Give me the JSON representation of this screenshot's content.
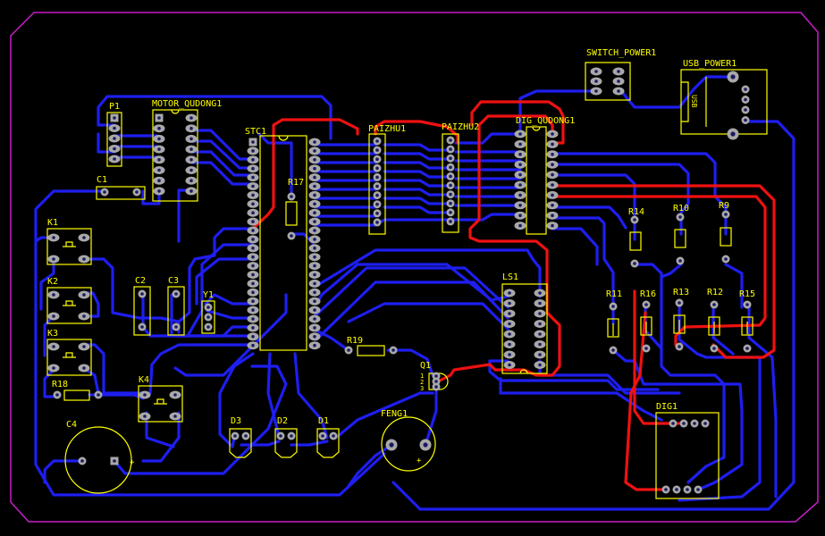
{
  "colors": {
    "background": "#000000",
    "board_edge": "#c81ec8",
    "silkscreen": "#ffff00",
    "bottom_copper": "#1e1ef0",
    "top_copper": "#ee1111",
    "pad": "#a8a8a8"
  },
  "labels": {
    "switch_power": "SWITCH_POWER1",
    "usb_power": "USB_POWER1",
    "usb_text": "USB",
    "p1": "P1",
    "motor": "MOTOR_QUDONG1",
    "stc": "STC1",
    "r17": "R17",
    "paizhu1": "PAIZHU1",
    "paizhu2": "PAIZHU2",
    "dig_qudong": "DIG_QUDONG1",
    "c1": "C1",
    "k1": "K1",
    "k2": "K2",
    "k3": "K3",
    "k4": "K4",
    "c2": "C2",
    "c3": "C3",
    "y1": "Y1",
    "ls1": "LS1",
    "r14": "R14",
    "r10": "R10",
    "r9": "R9",
    "r11": "R11",
    "r16": "R16",
    "r13": "R13",
    "r12": "R12",
    "r15": "R15",
    "r18": "R18",
    "c4": "C4",
    "r19": "R19",
    "q1": "Q1",
    "q1_pins": [
      "1",
      "2",
      "3"
    ],
    "feng": "FENG1",
    "d3": "D3",
    "d2": "D2",
    "d1": "D1",
    "dig1": "DIG1",
    "plus": "+"
  }
}
